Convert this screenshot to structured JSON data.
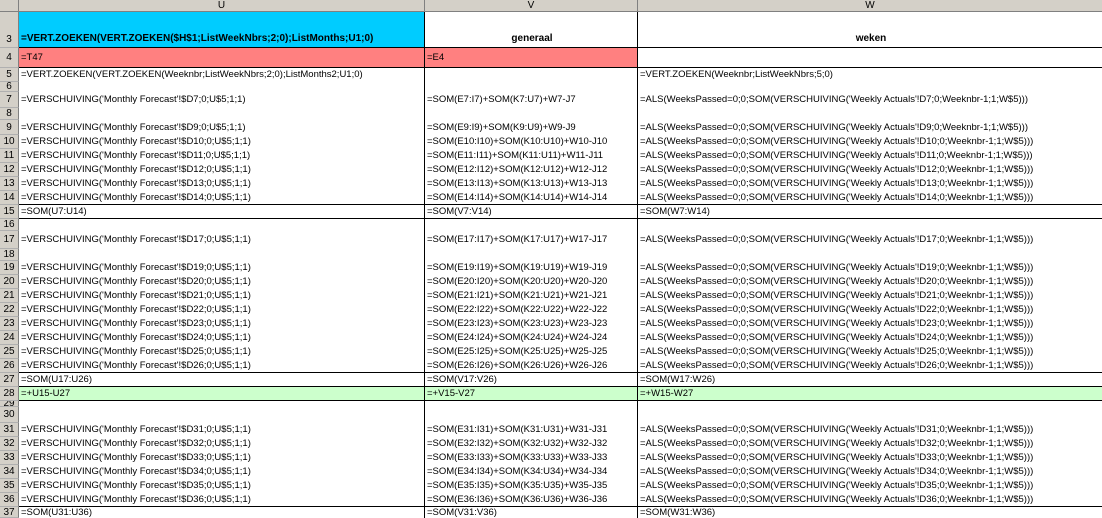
{
  "columns": [
    "U",
    "V",
    "W"
  ],
  "rows": [
    {
      "n": "3",
      "u": "=VERT.ZOEKEN(VERT.ZOEKEN($H$1;ListWeekNbrs;2;0);ListMonths;U1;0)",
      "v": "generaal",
      "w": "weken"
    },
    {
      "n": "4",
      "u": "=T47",
      "v": "=E4",
      "w": ""
    },
    {
      "n": "5",
      "u": "=VERT.ZOEKEN(VERT.ZOEKEN(Weeknbr;ListWeekNbrs;2;0);ListMonths2;U1;0)",
      "v": "",
      "w": "=VERT.ZOEKEN(Weeknbr;ListWeekNbrs;5;0)"
    },
    {
      "n": "6",
      "u": "",
      "v": "",
      "w": ""
    },
    {
      "n": "7",
      "u": "=VERSCHUIVING('Monthly Forecast'!$D7;0;U$5;1;1)",
      "v": "=SOM(E7:I7)+SOM(K7:U7)+W7-J7",
      "w": "=ALS(WeeksPassed=0;0;SOM(VERSCHUIVING('Weekly Actuals'!D7;0;Weeknbr-1;1;W$5)))"
    },
    {
      "n": "8",
      "u": "",
      "v": "",
      "w": ""
    },
    {
      "n": "9",
      "u": "=VERSCHUIVING('Monthly Forecast'!$D9;0;U$5;1;1)",
      "v": "=SOM(E9:I9)+SOM(K9:U9)+W9-J9",
      "w": "=ALS(WeeksPassed=0;0;SOM(VERSCHUIVING('Weekly Actuals'!D9;0;Weeknbr-1;1;W$5)))"
    },
    {
      "n": "10",
      "u": "=VERSCHUIVING('Monthly Forecast'!$D10;0;U$5;1;1)",
      "v": "=SOM(E10:I10)+SOM(K10:U10)+W10-J10",
      "w": "=ALS(WeeksPassed=0;0;SOM(VERSCHUIVING('Weekly Actuals'!D10;0;Weeknbr-1;1;W$5)))"
    },
    {
      "n": "11",
      "u": "=VERSCHUIVING('Monthly Forecast'!$D11;0;U$5;1;1)",
      "v": "=SOM(E11:I11)+SOM(K11:U11)+W11-J11",
      "w": "=ALS(WeeksPassed=0;0;SOM(VERSCHUIVING('Weekly Actuals'!D11;0;Weeknbr-1;1;W$5)))"
    },
    {
      "n": "12",
      "u": "=VERSCHUIVING('Monthly Forecast'!$D12;0;U$5;1;1)",
      "v": "=SOM(E12:I12)+SOM(K12:U12)+W12-J12",
      "w": "=ALS(WeeksPassed=0;0;SOM(VERSCHUIVING('Weekly Actuals'!D12;0;Weeknbr-1;1;W$5)))"
    },
    {
      "n": "13",
      "u": "=VERSCHUIVING('Monthly Forecast'!$D13;0;U$5;1;1)",
      "v": "=SOM(E13:I13)+SOM(K13:U13)+W13-J13",
      "w": "=ALS(WeeksPassed=0;0;SOM(VERSCHUIVING('Weekly Actuals'!D13;0;Weeknbr-1;1;W$5)))"
    },
    {
      "n": "14",
      "u": "=VERSCHUIVING('Monthly Forecast'!$D14;0;U$5;1;1)",
      "v": "=SOM(E14:I14)+SOM(K14:U14)+W14-J14",
      "w": "=ALS(WeeksPassed=0;0;SOM(VERSCHUIVING('Weekly Actuals'!D14;0;Weeknbr-1;1;W$5)))"
    },
    {
      "n": "15",
      "u": "=SOM(U7:U14)",
      "v": "=SOM(V7:V14)",
      "w": "=SOM(W7:W14)"
    },
    {
      "n": "16",
      "u": "",
      "v": "",
      "w": ""
    },
    {
      "n": "17",
      "u": "=VERSCHUIVING('Monthly Forecast'!$D17;0;U$5;1;1)",
      "v": "=SOM(E17:I17)+SOM(K17:U17)+W17-J17",
      "w": "=ALS(WeeksPassed=0;0;SOM(VERSCHUIVING('Weekly Actuals'!D17;0;Weeknbr-1;1;W$5)))"
    },
    {
      "n": "18",
      "u": "",
      "v": "",
      "w": ""
    },
    {
      "n": "19",
      "u": "=VERSCHUIVING('Monthly Forecast'!$D19;0;U$5;1;1)",
      "v": "=SOM(E19:I19)+SOM(K19:U19)+W19-J19",
      "w": "=ALS(WeeksPassed=0;0;SOM(VERSCHUIVING('Weekly Actuals'!D19;0;Weeknbr-1;1;W$5)))"
    },
    {
      "n": "20",
      "u": "=VERSCHUIVING('Monthly Forecast'!$D20;0;U$5;1;1)",
      "v": "=SOM(E20:I20)+SOM(K20:U20)+W20-J20",
      "w": "=ALS(WeeksPassed=0;0;SOM(VERSCHUIVING('Weekly Actuals'!D20;0;Weeknbr-1;1;W$5)))"
    },
    {
      "n": "21",
      "u": "=VERSCHUIVING('Monthly Forecast'!$D21;0;U$5;1;1)",
      "v": "=SOM(E21:I21)+SOM(K21:U21)+W21-J21",
      "w": "=ALS(WeeksPassed=0;0;SOM(VERSCHUIVING('Weekly Actuals'!D21;0;Weeknbr-1;1;W$5)))"
    },
    {
      "n": "22",
      "u": "=VERSCHUIVING('Monthly Forecast'!$D22;0;U$5;1;1)",
      "v": "=SOM(E22:I22)+SOM(K22:U22)+W22-J22",
      "w": "=ALS(WeeksPassed=0;0;SOM(VERSCHUIVING('Weekly Actuals'!D22;0;Weeknbr-1;1;W$5)))"
    },
    {
      "n": "23",
      "u": "=VERSCHUIVING('Monthly Forecast'!$D23;0;U$5;1;1)",
      "v": "=SOM(E23:I23)+SOM(K23:U23)+W23-J23",
      "w": "=ALS(WeeksPassed=0;0;SOM(VERSCHUIVING('Weekly Actuals'!D23;0;Weeknbr-1;1;W$5)))"
    },
    {
      "n": "24",
      "u": "=VERSCHUIVING('Monthly Forecast'!$D24;0;U$5;1;1)",
      "v": "=SOM(E24:I24)+SOM(K24:U24)+W24-J24",
      "w": "=ALS(WeeksPassed=0;0;SOM(VERSCHUIVING('Weekly Actuals'!D24;0;Weeknbr-1;1;W$5)))"
    },
    {
      "n": "25",
      "u": "=VERSCHUIVING('Monthly Forecast'!$D25;0;U$5;1;1)",
      "v": "=SOM(E25:I25)+SOM(K25:U25)+W25-J25",
      "w": "=ALS(WeeksPassed=0;0;SOM(VERSCHUIVING('Weekly Actuals'!D25;0;Weeknbr-1;1;W$5)))"
    },
    {
      "n": "26",
      "u": "=VERSCHUIVING('Monthly Forecast'!$D26;0;U$5;1;1)",
      "v": "=SOM(E26:I26)+SOM(K26:U26)+W26-J26",
      "w": "=ALS(WeeksPassed=0;0;SOM(VERSCHUIVING('Weekly Actuals'!D26;0;Weeknbr-1;1;W$5)))"
    },
    {
      "n": "27",
      "u": "=SOM(U17:U26)",
      "v": "=SOM(V17:V26)",
      "w": "=SOM(W17:W26)"
    },
    {
      "n": "28",
      "u": "=+U15-U27",
      "v": "=+V15-V27",
      "w": "=+W15-W27"
    },
    {
      "n": "29",
      "u": "",
      "v": "",
      "w": ""
    },
    {
      "n": "30",
      "u": "",
      "v": "",
      "w": ""
    },
    {
      "n": "31",
      "u": "=VERSCHUIVING('Monthly Forecast'!$D31;0;U$5;1;1)",
      "v": "=SOM(E31:I31)+SOM(K31:U31)+W31-J31",
      "w": "=ALS(WeeksPassed=0;0;SOM(VERSCHUIVING('Weekly Actuals'!D31;0;Weeknbr-1;1;W$5)))"
    },
    {
      "n": "32",
      "u": "=VERSCHUIVING('Monthly Forecast'!$D32;0;U$5;1;1)",
      "v": "=SOM(E32:I32)+SOM(K32:U32)+W32-J32",
      "w": "=ALS(WeeksPassed=0;0;SOM(VERSCHUIVING('Weekly Actuals'!D32;0;Weeknbr-1;1;W$5)))"
    },
    {
      "n": "33",
      "u": "=VERSCHUIVING('Monthly Forecast'!$D33;0;U$5;1;1)",
      "v": "=SOM(E33:I33)+SOM(K33:U33)+W33-J33",
      "w": "=ALS(WeeksPassed=0;0;SOM(VERSCHUIVING('Weekly Actuals'!D33;0;Weeknbr-1;1;W$5)))"
    },
    {
      "n": "34",
      "u": "=VERSCHUIVING('Monthly Forecast'!$D34;0;U$5;1;1)",
      "v": "=SOM(E34:I34)+SOM(K34:U34)+W34-J34",
      "w": "=ALS(WeeksPassed=0;0;SOM(VERSCHUIVING('Weekly Actuals'!D34;0;Weeknbr-1;1;W$5)))"
    },
    {
      "n": "35",
      "u": "=VERSCHUIVING('Monthly Forecast'!$D35;0;U$5;1;1)",
      "v": "=SOM(E35:I35)+SOM(K35:U35)+W35-J35",
      "w": "=ALS(WeeksPassed=0;0;SOM(VERSCHUIVING('Weekly Actuals'!D35;0;Weeknbr-1;1;W$5)))"
    },
    {
      "n": "36",
      "u": "=VERSCHUIVING('Monthly Forecast'!$D36;0;U$5;1;1)",
      "v": "=SOM(E36:I36)+SOM(K36:U36)+W36-J36",
      "w": "=ALS(WeeksPassed=0;0;SOM(VERSCHUIVING('Weekly Actuals'!D36;0;Weeknbr-1;1;W$5)))"
    },
    {
      "n": "37",
      "u": "=SOM(U31:U36)",
      "v": "=SOM(V31:V36)",
      "w": "=SOM(W31:W36)"
    }
  ],
  "colors": {
    "header_cyan": "#00ccff",
    "pink": "#ff8080",
    "light_green": "#ccffcc",
    "header_gray": "#d4d0c8"
  }
}
